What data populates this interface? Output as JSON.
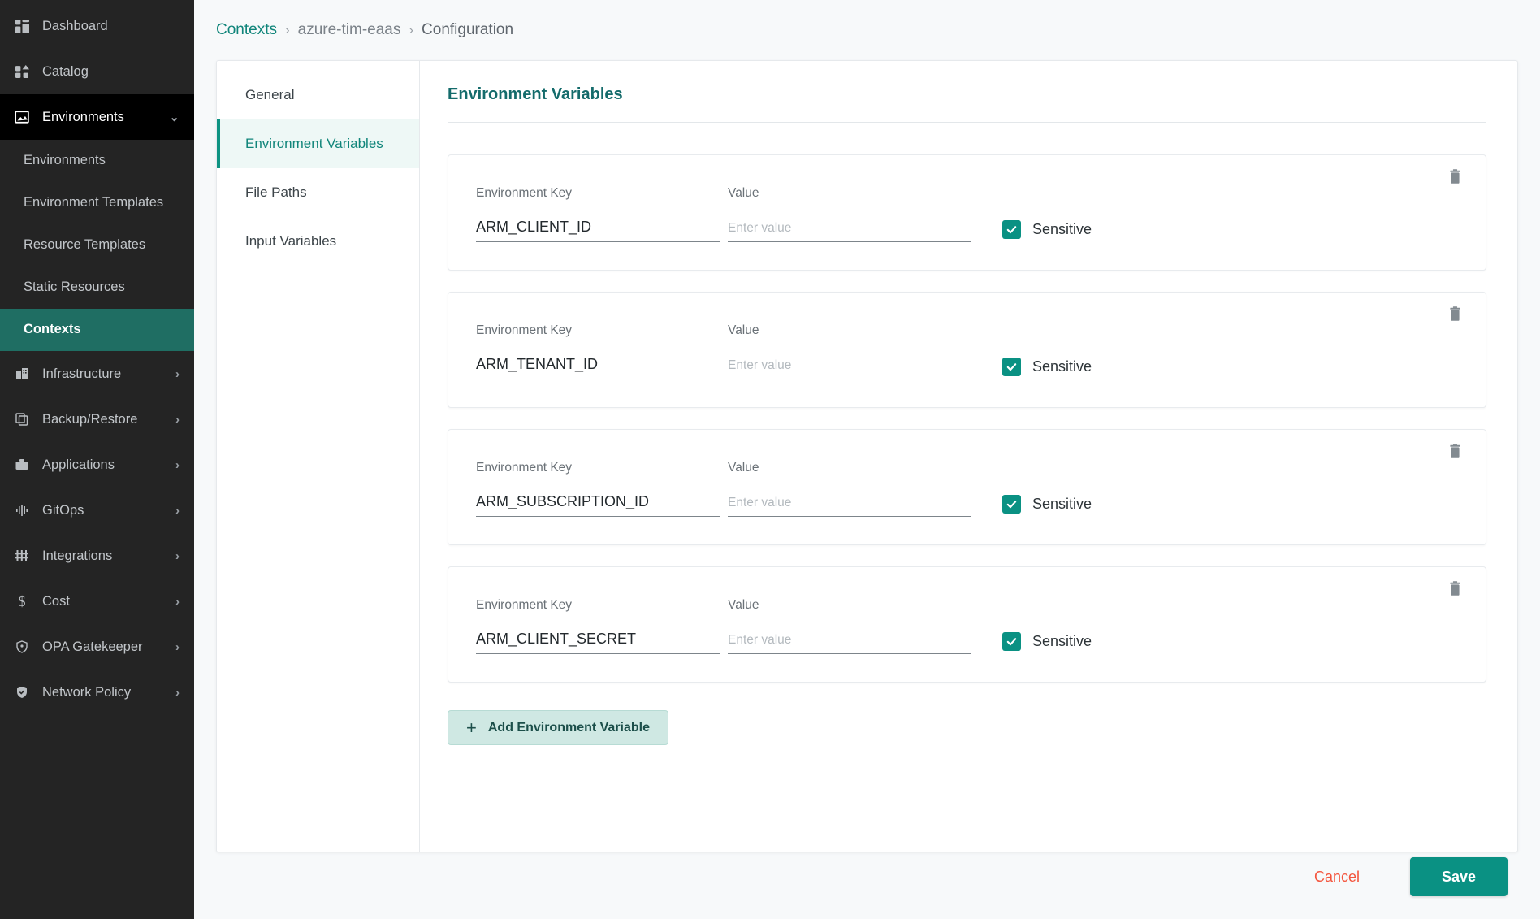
{
  "sidebar": {
    "items": [
      {
        "label": "Dashboard",
        "icon": "dashboard-icon",
        "state": "normal",
        "chevron": ""
      },
      {
        "label": "Catalog",
        "icon": "catalog-icon",
        "state": "normal",
        "chevron": ""
      },
      {
        "label": "Environments",
        "icon": "environments-icon",
        "state": "expanded",
        "chevron": "⌄"
      }
    ],
    "sub_items": [
      {
        "label": "Environments",
        "state": "normal"
      },
      {
        "label": "Environment Templates",
        "state": "normal"
      },
      {
        "label": "Resource Templates",
        "state": "normal"
      },
      {
        "label": "Static Resources",
        "state": "normal"
      },
      {
        "label": "Contexts",
        "state": "active"
      }
    ],
    "items_lower": [
      {
        "label": "Infrastructure",
        "icon": "building-icon",
        "chevron": "›"
      },
      {
        "label": "Backup/Restore",
        "icon": "copy-icon",
        "chevron": "›"
      },
      {
        "label": "Applications",
        "icon": "briefcase-icon",
        "chevron": "›"
      },
      {
        "label": "GitOps",
        "icon": "waveform-icon",
        "chevron": "›"
      },
      {
        "label": "Integrations",
        "icon": "sliders-icon",
        "chevron": "›"
      },
      {
        "label": "Cost",
        "icon": "dollar-icon",
        "chevron": "›"
      },
      {
        "label": "OPA Gatekeeper",
        "icon": "shield-icon",
        "chevron": "›"
      },
      {
        "label": "Network Policy",
        "icon": "shield-check-icon",
        "chevron": "›"
      }
    ]
  },
  "breadcrumb": {
    "root": "Contexts",
    "separator": "›",
    "middle": "azure-tim-eaas",
    "current": "Configuration"
  },
  "tabs": [
    {
      "label": "General",
      "active": false
    },
    {
      "label": "Environment Variables",
      "active": true
    },
    {
      "label": "File Paths",
      "active": false
    },
    {
      "label": "Input Variables",
      "active": false
    }
  ],
  "section": {
    "title": "Environment Variables",
    "key_label": "Environment Key",
    "value_label": "Value",
    "value_placeholder": "Enter value",
    "sensitive_label": "Sensitive"
  },
  "variables": [
    {
      "key": "ARM_CLIENT_ID",
      "value": "",
      "sensitive": true
    },
    {
      "key": "ARM_TENANT_ID",
      "value": "",
      "sensitive": true
    },
    {
      "key": "ARM_SUBSCRIPTION_ID",
      "value": "",
      "sensitive": true
    },
    {
      "key": "ARM_CLIENT_SECRET",
      "value": "",
      "sensitive": true
    }
  ],
  "add_button": {
    "label": "Add Environment Variable",
    "plus": "+"
  },
  "footer": {
    "cancel": "Cancel",
    "save": "Save"
  },
  "colors": {
    "accent_teal": "#0a9183",
    "sidebar_bg": "#242424",
    "active_nav": "#1f6e63",
    "cancel_red": "#f4543c",
    "heading_teal": "#146b6b",
    "add_btn_bg": "#cfe8e3"
  }
}
